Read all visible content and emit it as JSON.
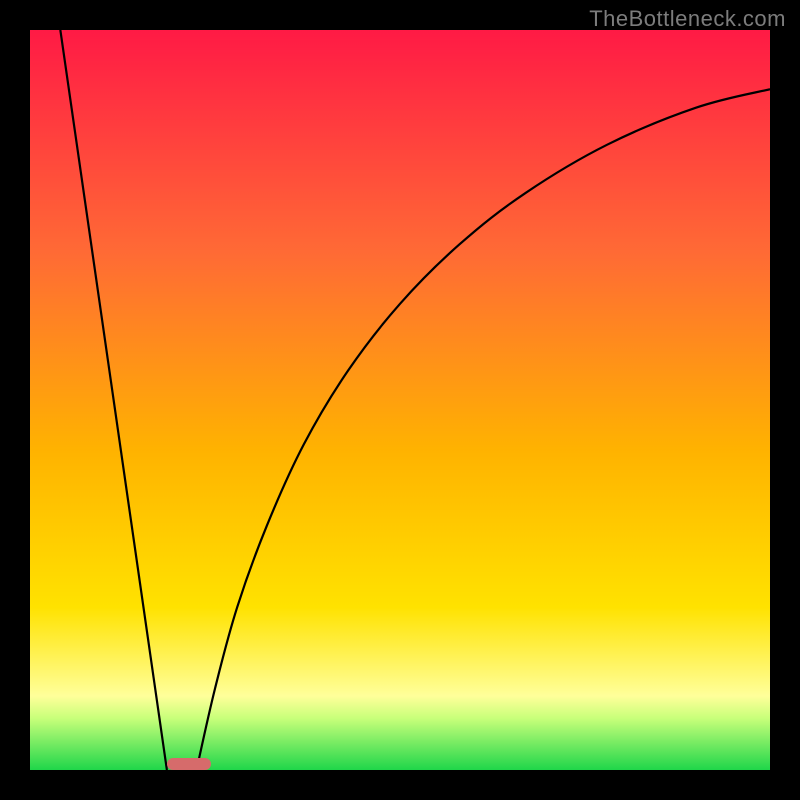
{
  "watermark": "TheBottleneck.com",
  "gradient": {
    "top": "#ff1a45",
    "upper": "#ff6a35",
    "mid": "#ffb300",
    "lower": "#ffe200",
    "pale": "#ffff9a",
    "band": "#c8ff7a",
    "bottom": "#1fd64a"
  },
  "marker": {
    "color": "#d66b6b",
    "left_frac": 0.185,
    "width_frac": 0.06
  },
  "chart_data": {
    "type": "line",
    "title": "",
    "xlabel": "",
    "ylabel": "",
    "xlim": [
      0,
      100
    ],
    "ylim": [
      0,
      100
    ],
    "series": [
      {
        "name": "left-segment",
        "x": [
          4.1,
          18.5
        ],
        "y": [
          100,
          0
        ]
      },
      {
        "name": "right-curve",
        "x": [
          22.5,
          25,
          28,
          32,
          37,
          43,
          50,
          58,
          67,
          78,
          90,
          100
        ],
        "y": [
          0,
          11,
          22,
          33,
          44,
          54,
          63,
          71,
          78,
          84.5,
          89.5,
          92
        ]
      }
    ],
    "annotations": [
      {
        "name": "minimum-marker",
        "x": 20.5,
        "y": 0
      }
    ]
  }
}
